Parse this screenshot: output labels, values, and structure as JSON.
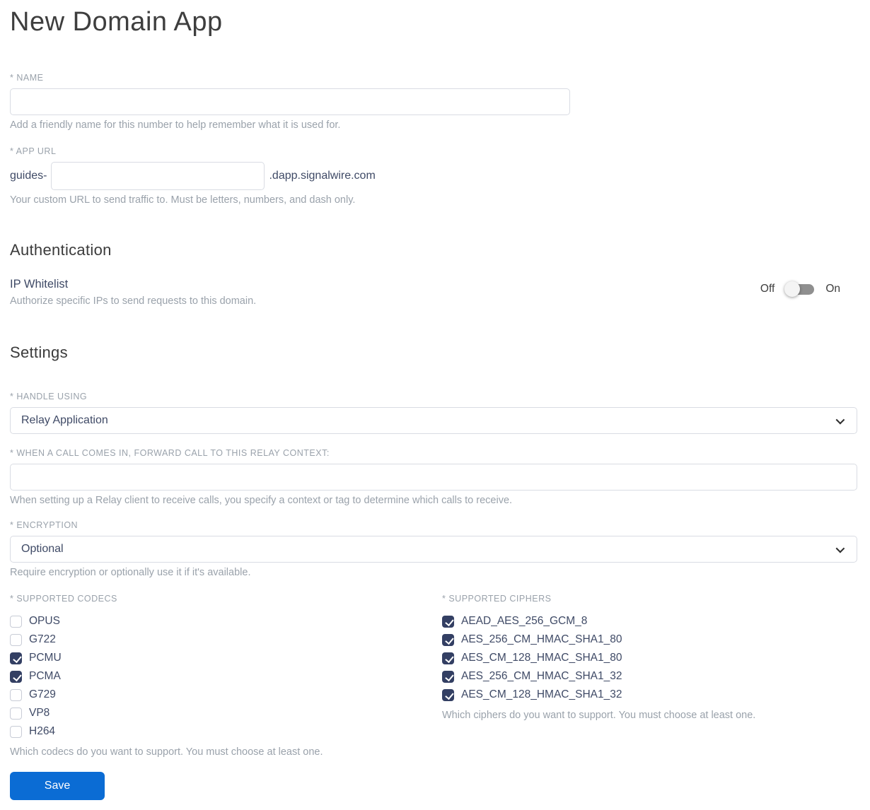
{
  "page": {
    "title": "New Domain App"
  },
  "name_field": {
    "label": "* NAME",
    "value": "",
    "helper": "Add a friendly name for this number to help remember what it is used for."
  },
  "app_url_field": {
    "label": "* APP URL",
    "prefix": "guides-",
    "value": "",
    "suffix": ".dapp.signalwire.com",
    "helper": "Your custom URL to send traffic to. Must be letters, numbers, and dash only."
  },
  "authentication": {
    "heading": "Authentication",
    "ip_whitelist": {
      "label": "IP Whitelist",
      "helper": "Authorize specific IPs to send requests to this domain.",
      "off_label": "Off",
      "on_label": "On",
      "state": "off"
    }
  },
  "settings": {
    "heading": "Settings",
    "handle_using": {
      "label": "* HANDLE USING",
      "value": "Relay Application"
    },
    "relay_context": {
      "label": "* WHEN A CALL COMES IN, FORWARD CALL TO THIS RELAY CONTEXT:",
      "value": "",
      "helper": "When setting up a Relay client to receive calls, you specify a context or tag to determine which calls to receive."
    },
    "encryption": {
      "label": "* ENCRYPTION",
      "value": "Optional",
      "helper": "Require encryption or optionally use it if it's available."
    },
    "codecs": {
      "label": "* SUPPORTED CODECS",
      "items": [
        {
          "label": "OPUS",
          "checked": false
        },
        {
          "label": "G722",
          "checked": false
        },
        {
          "label": "PCMU",
          "checked": true
        },
        {
          "label": "PCMA",
          "checked": true
        },
        {
          "label": "G729",
          "checked": false
        },
        {
          "label": "VP8",
          "checked": false
        },
        {
          "label": "H264",
          "checked": false
        }
      ],
      "helper": "Which codecs do you want to support. You must choose at least one."
    },
    "ciphers": {
      "label": "* SUPPORTED CIPHERS",
      "items": [
        {
          "label": "AEAD_AES_256_GCM_8",
          "checked": true
        },
        {
          "label": "AES_256_CM_HMAC_SHA1_80",
          "checked": true
        },
        {
          "label": "AES_CM_128_HMAC_SHA1_80",
          "checked": true
        },
        {
          "label": "AES_256_CM_HMAC_SHA1_32",
          "checked": true
        },
        {
          "label": "AES_CM_128_HMAC_SHA1_32",
          "checked": true
        }
      ],
      "helper": "Which ciphers do you want to support. You must choose at least one."
    }
  },
  "save_button": {
    "label": "Save"
  },
  "colors": {
    "accent_blue": "#0b6cd4",
    "checkbox_checked": "#333f63",
    "toggle_track": "#8f8f8f",
    "toggle_knob": "#f4f4f4",
    "label_gray": "#9aa2ab",
    "body_slate": "#3f4a66",
    "heading_gray": "#3b3b3b",
    "input_border": "#d9dce3"
  }
}
